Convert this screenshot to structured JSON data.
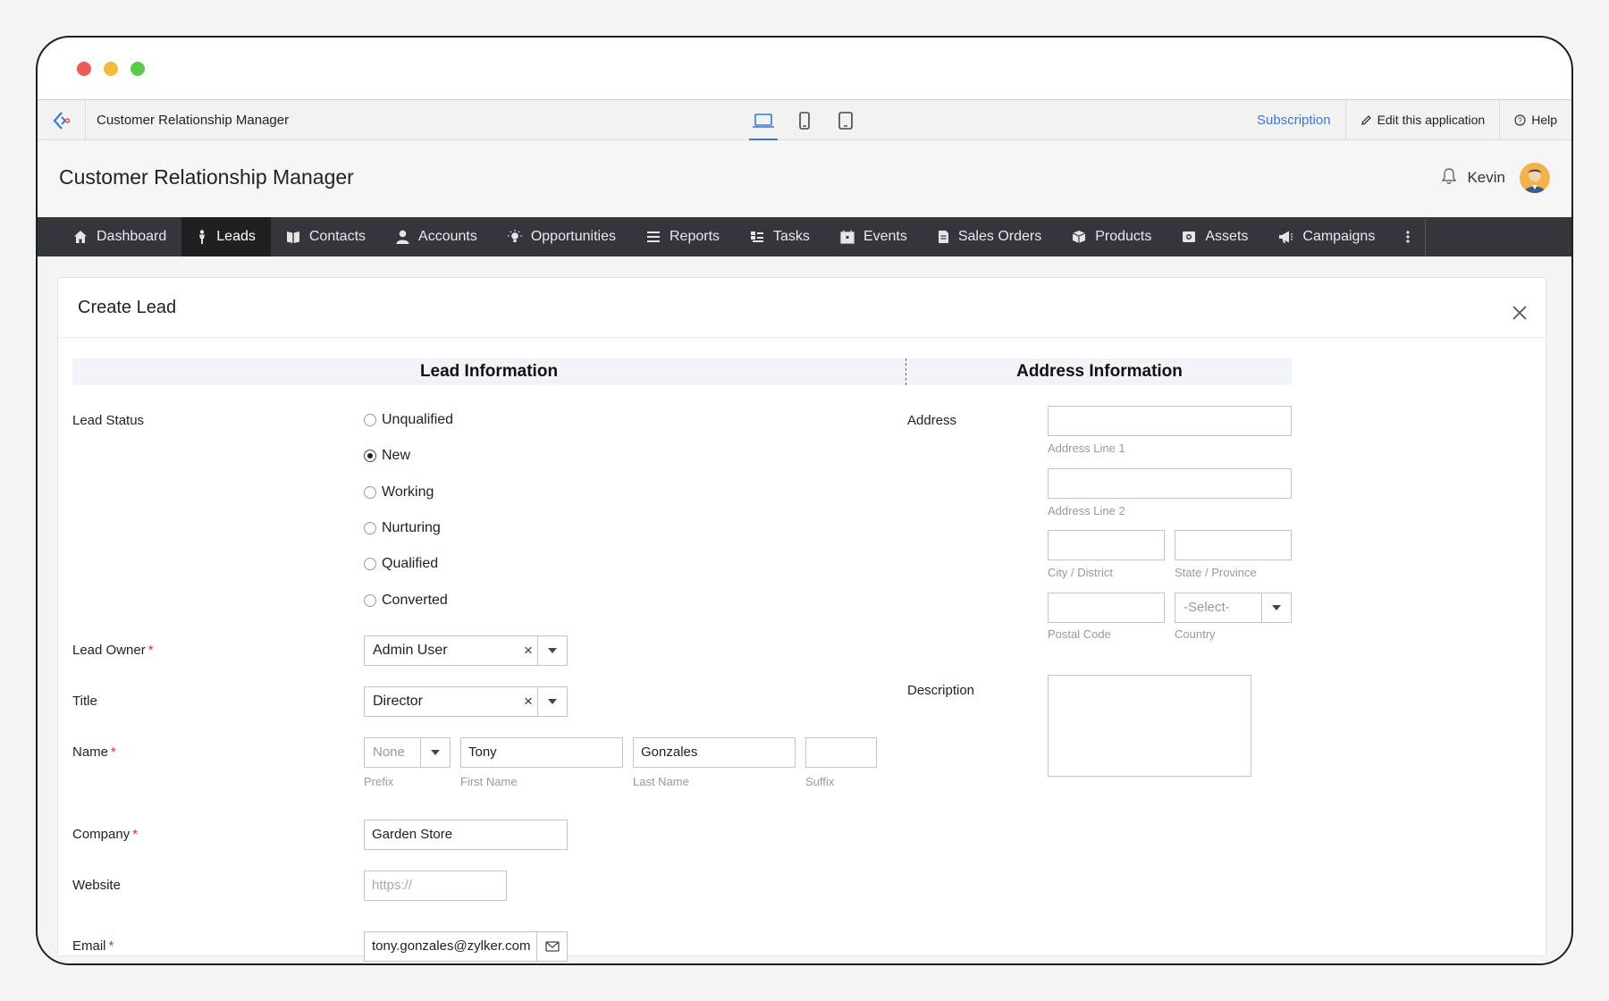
{
  "app": {
    "name": "Customer Relationship Manager",
    "subscription_label": "Subscription",
    "edit_label": "Edit this application",
    "help_label": "Help"
  },
  "header": {
    "title": "Customer Relationship Manager",
    "user_name": "Kevin"
  },
  "nav": {
    "items": [
      {
        "label": "Dashboard",
        "icon": "home-icon"
      },
      {
        "label": "Leads",
        "icon": "person-icon",
        "active": true
      },
      {
        "label": "Contacts",
        "icon": "book-icon"
      },
      {
        "label": "Accounts",
        "icon": "user-icon"
      },
      {
        "label": "Opportunities",
        "icon": "bulb-icon"
      },
      {
        "label": "Reports",
        "icon": "list-icon"
      },
      {
        "label": "Tasks",
        "icon": "tasks-icon"
      },
      {
        "label": "Events",
        "icon": "calendar-icon"
      },
      {
        "label": "Sales Orders",
        "icon": "document-icon"
      },
      {
        "label": "Products",
        "icon": "box-icon"
      },
      {
        "label": "Assets",
        "icon": "asset-icon"
      },
      {
        "label": "Campaigns",
        "icon": "megaphone-icon"
      }
    ]
  },
  "form": {
    "title": "Create Lead",
    "lead_section": "Lead Information",
    "address_section": "Address Information",
    "lead_status_label": "Lead Status",
    "status_options": [
      "Unqualified",
      "New",
      "Working",
      "Nurturing",
      "Qualified",
      "Converted"
    ],
    "status_selected": "New",
    "lead_owner_label": "Lead Owner",
    "lead_owner_value": "Admin User",
    "title_label": "Title",
    "title_value": "Director",
    "name_label": "Name",
    "prefix_value": "None",
    "first_name_value": "Tony",
    "last_name_value": "Gonzales",
    "suffix_value": "",
    "prefix_hint": "Prefix",
    "first_name_hint": "First Name",
    "last_name_hint": "Last Name",
    "suffix_hint": "Suffix",
    "company_label": "Company",
    "company_value": "Garden Store",
    "website_label": "Website",
    "website_placeholder": "https://",
    "email_label": "Email",
    "email_value": "tony.gonzales@zylker.com",
    "required_mark": "*",
    "address_label": "Address",
    "address_line1_hint": "Address Line 1",
    "address_line2_hint": "Address Line 2",
    "city_hint": "City / District",
    "state_hint": "State / Province",
    "postal_hint": "Postal Code",
    "country_hint": "Country",
    "country_placeholder": "-Select-",
    "description_label": "Description"
  }
}
